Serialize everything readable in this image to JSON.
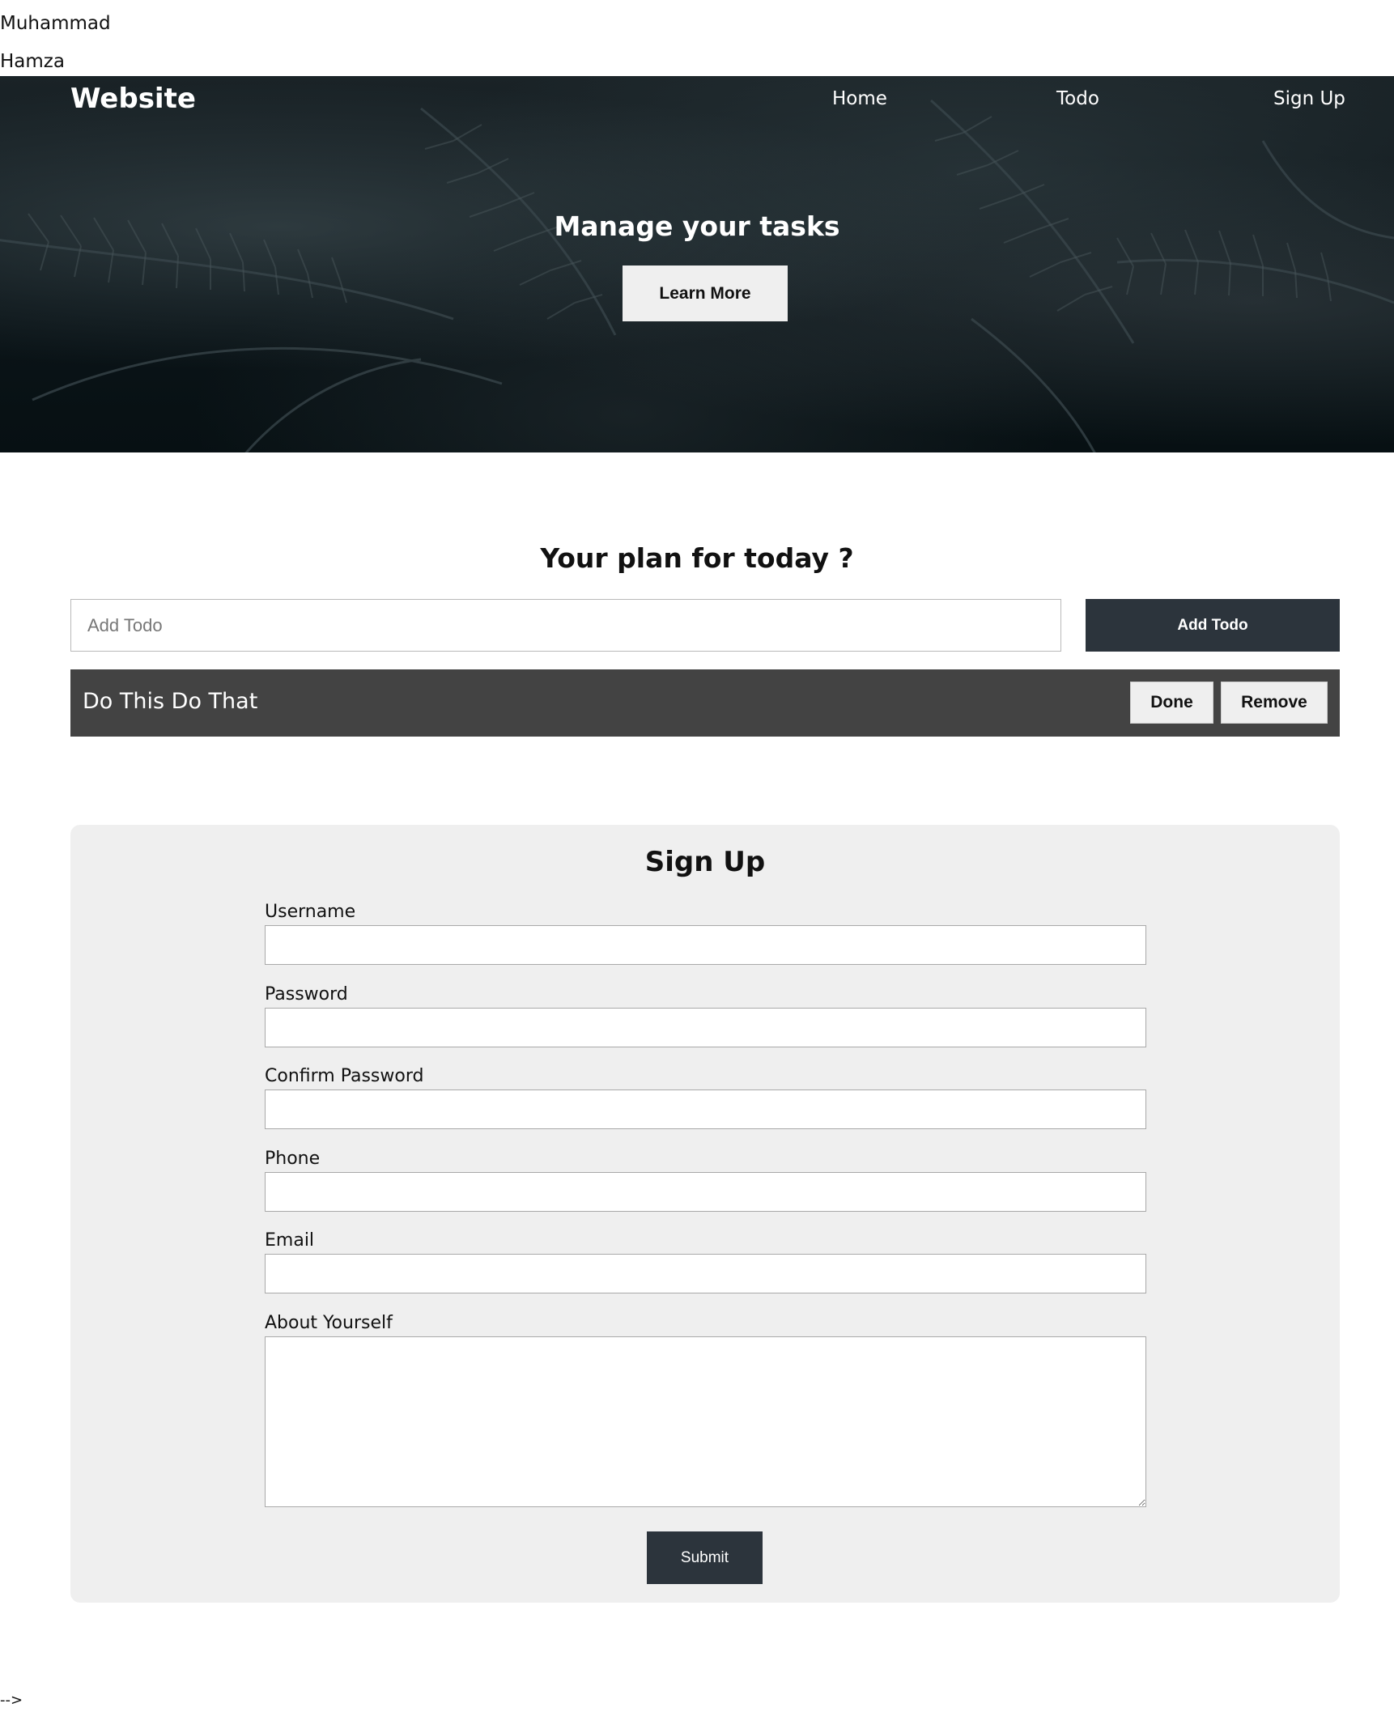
{
  "top": {
    "first_name": "Muhammad",
    "last_name": "Hamza"
  },
  "nav": {
    "brand": "Website",
    "links": [
      "Home",
      "Todo",
      "Sign Up"
    ]
  },
  "hero": {
    "title": "Manage your tasks",
    "button_label": "Learn More"
  },
  "todo": {
    "heading": "Your plan for today ?",
    "input_placeholder": "Add Todo",
    "input_value": "",
    "add_button_label": "Add Todo",
    "items": [
      {
        "text": "Do This Do That",
        "done_label": "Done",
        "remove_label": "Remove"
      }
    ]
  },
  "signup": {
    "title": "Sign Up",
    "fields": [
      {
        "label": "Username",
        "value": ""
      },
      {
        "label": "Password",
        "value": ""
      },
      {
        "label": "Confirm Password",
        "value": ""
      },
      {
        "label": "Phone",
        "value": ""
      },
      {
        "label": "Email",
        "value": ""
      },
      {
        "label": "About Yourself",
        "value": ""
      }
    ],
    "submit_label": "Submit"
  },
  "footer": {
    "stray_text": "-->"
  },
  "colors": {
    "dark_button": "#2c343c",
    "todo_bar": "#434343",
    "card_bg": "#efefef",
    "light_button": "#efefef"
  }
}
